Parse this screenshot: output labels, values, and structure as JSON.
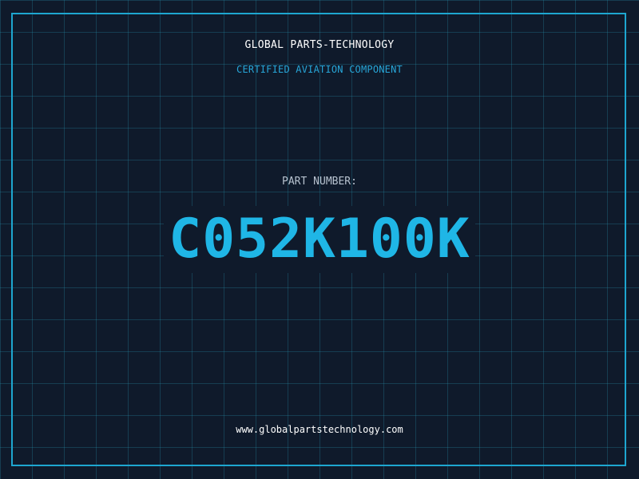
{
  "header": {
    "company": "GLOBAL PARTS-TECHNOLOGY",
    "subtitle": "CERTIFIED AVIATION COMPONENT"
  },
  "part": {
    "label": "PART NUMBER:",
    "number": "C052K100K"
  },
  "footer": {
    "website": "www.globalpartstechnology.com"
  },
  "colors": {
    "background": "#0f1a2b",
    "grid": "#2696b4",
    "frame": "#1ea6d0",
    "accent": "#1fb6e6",
    "text": "#ffffff",
    "label": "#b7c2cf"
  }
}
